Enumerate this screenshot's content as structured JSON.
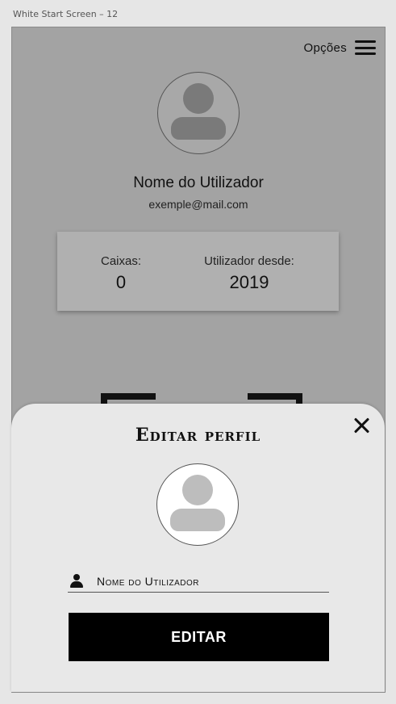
{
  "artboard": {
    "label": "White Start Screen – 12"
  },
  "header": {
    "options_label": "Opções",
    "menu_icon": "hamburger-menu-icon"
  },
  "profile": {
    "avatar_icon": "user-avatar-icon",
    "name": "Nome do Utilizador",
    "email": "exemple@mail.com"
  },
  "stats": {
    "boxes_label": "Caixas:",
    "boxes_value": "0",
    "since_label": "Utilizador desde:",
    "since_value": "2019"
  },
  "edit_sheet": {
    "title": "Editar perfil",
    "close_icon": "close-icon",
    "avatar_icon": "user-avatar-icon",
    "name_field": {
      "icon": "person-icon",
      "placeholder": "Nome do Utilizador",
      "value": ""
    },
    "submit_label": "EDITAR"
  },
  "colors": {
    "background": "#e6e6e6",
    "overlay": "#a3a3a3",
    "sheet": "#e8e8e8",
    "button": "#000000"
  }
}
